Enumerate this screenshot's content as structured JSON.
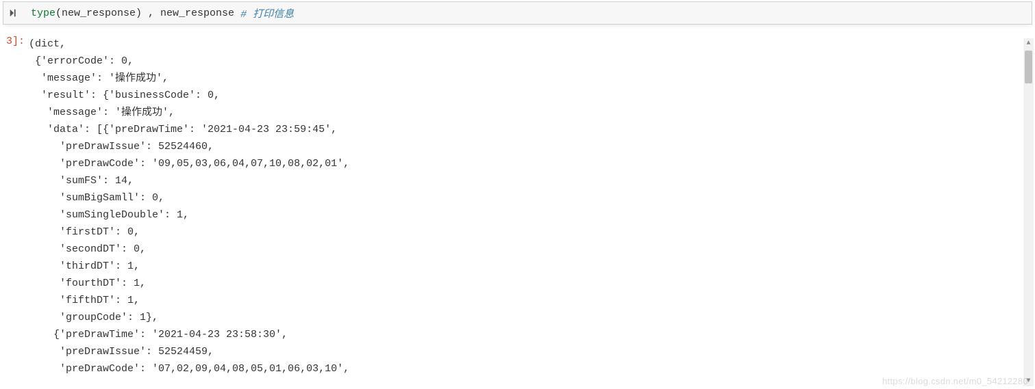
{
  "input": {
    "builtin": "type",
    "plain": "(new_response) , new_response ",
    "comment": "# 打印信息"
  },
  "prompt": "3]:",
  "output_lines": [
    "(dict,",
    " {'errorCode': 0,",
    "  'message': '操作成功',",
    "  'result': {'businessCode': 0,",
    "   'message': '操作成功',",
    "   'data': [{'preDrawTime': '2021-04-23 23:59:45',",
    "     'preDrawIssue': 52524460,",
    "     'preDrawCode': '09,05,03,06,04,07,10,08,02,01',",
    "     'sumFS': 14,",
    "     'sumBigSamll': 0,",
    "     'sumSingleDouble': 1,",
    "     'firstDT': 0,",
    "     'secondDT': 0,",
    "     'thirdDT': 1,",
    "     'fourthDT': 1,",
    "     'fifthDT': 1,",
    "     'groupCode': 1},",
    "    {'preDrawTime': '2021-04-23 23:58:30',",
    "     'preDrawIssue': 52524459,",
    "     'preDrawCode': '07,02,09,04,08,05,01,06,03,10',"
  ],
  "scrollbar": {
    "up": "▲",
    "down": "▼"
  },
  "watermark": "https://blog.csdn.net/m0_54212280"
}
